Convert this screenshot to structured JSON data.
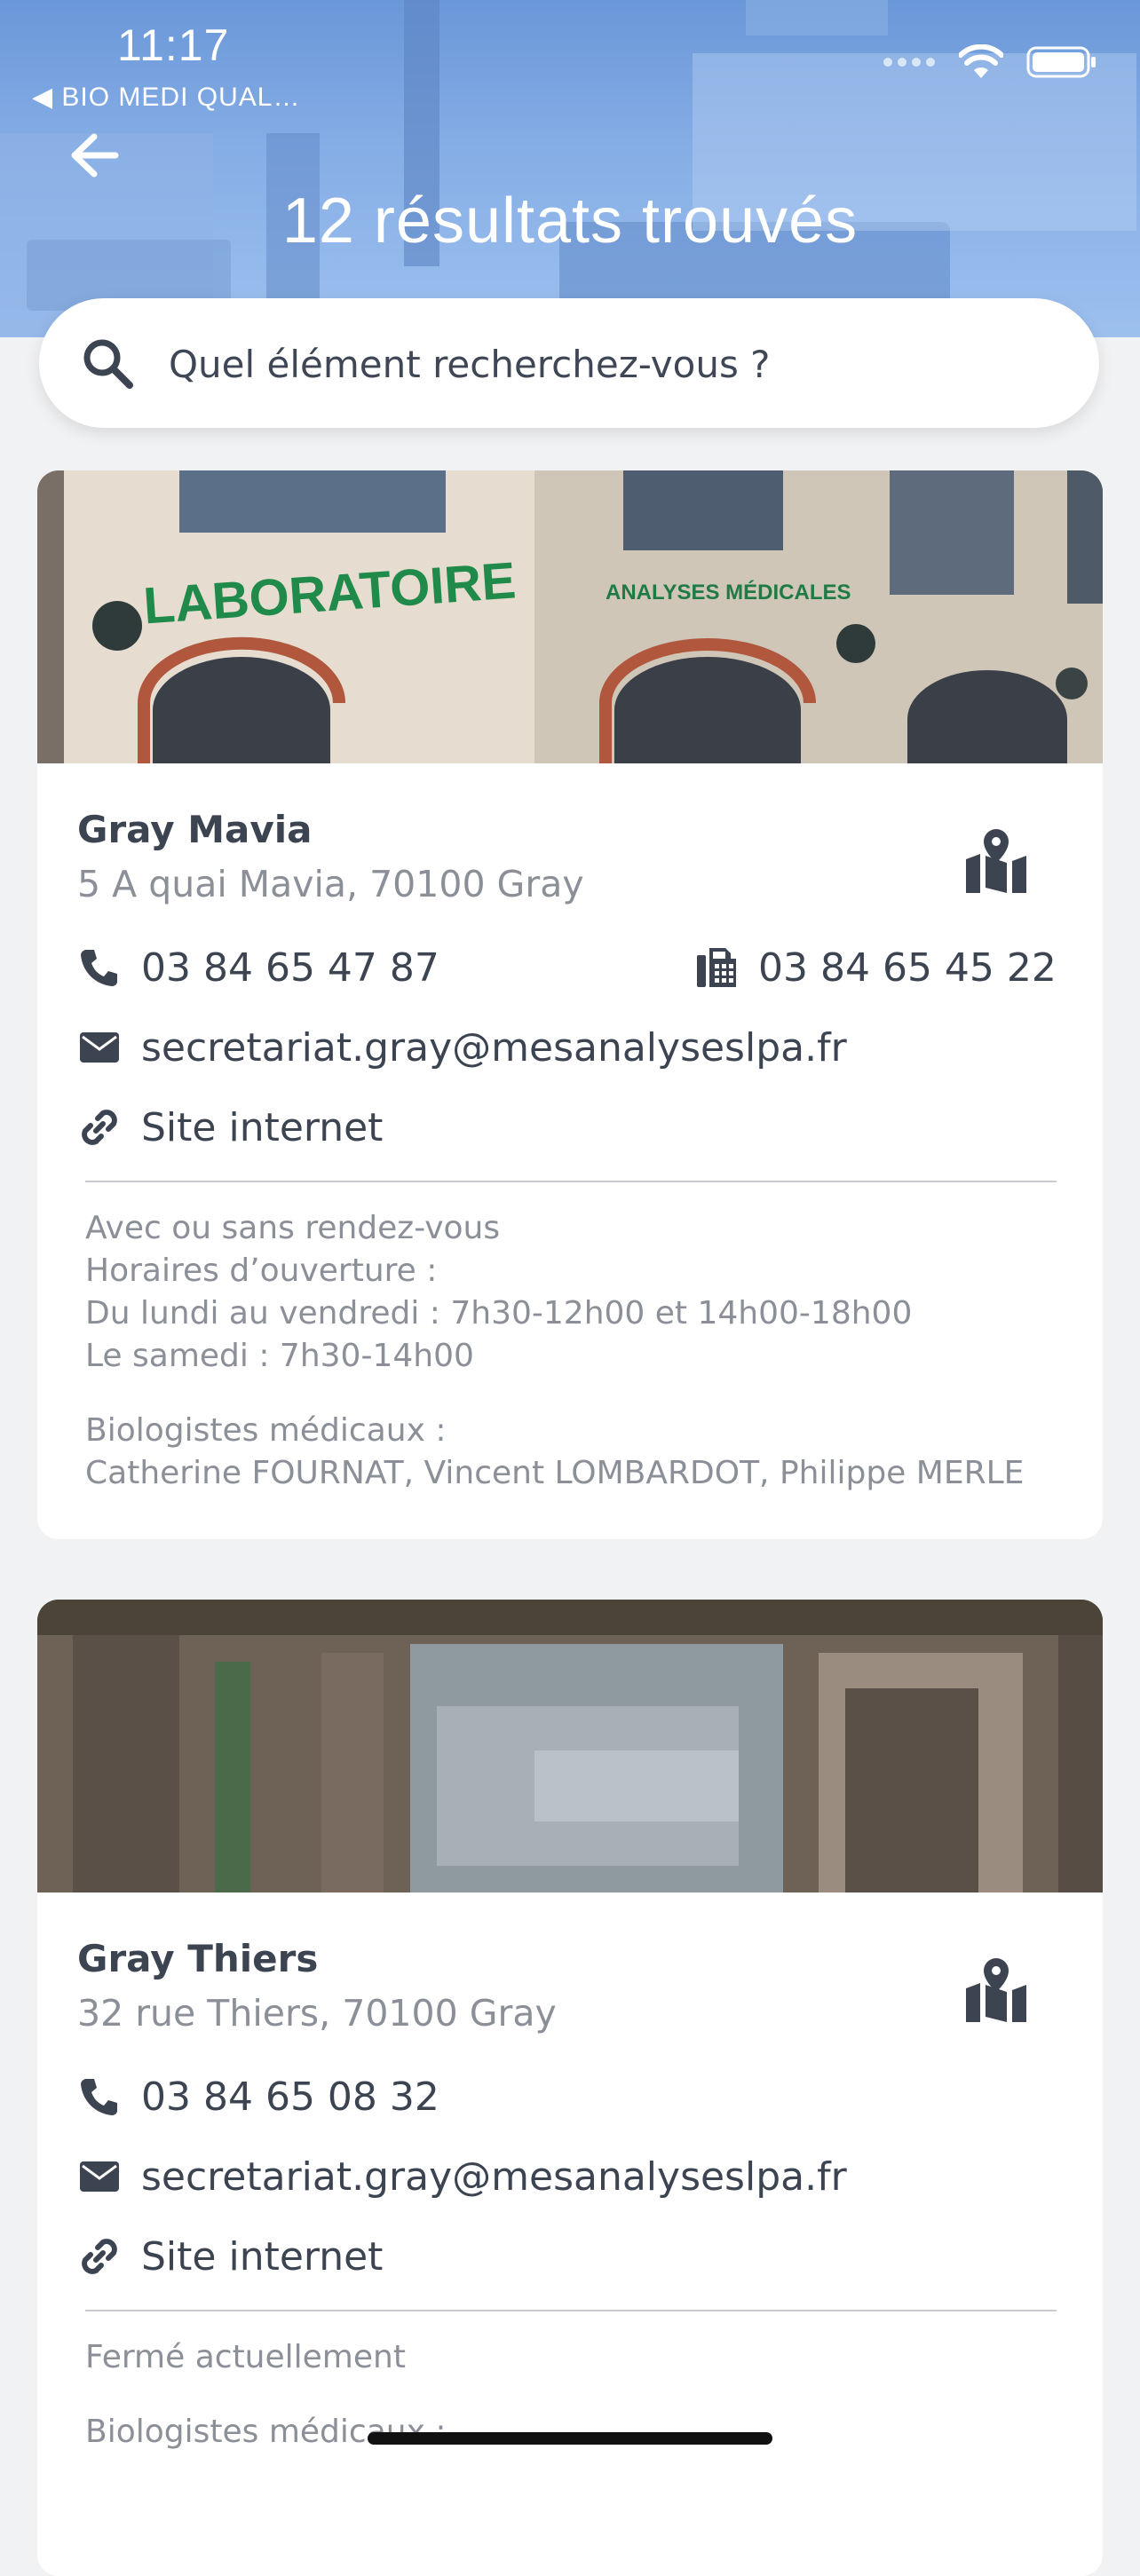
{
  "status_bar": {
    "time": "11:17",
    "back_app": "◀ BIO MEDI QUAL…"
  },
  "header": {
    "title": "12 résultats trouvés"
  },
  "search": {
    "placeholder": "Quel élément recherchez-vous ?"
  },
  "labs": [
    {
      "name": "Gray Mavia",
      "address": "5 A quai Mavia, 70100 Gray",
      "phone": "03 84 65 47 87",
      "fax": "03 84 65 45 22",
      "email": "secretariat.gray@mesanalyseslpa.fr",
      "website": "Site internet",
      "hours": [
        "Avec ou sans rendez-vous",
        "Horaires d’ouverture :",
        "Du lundi au vendredi : 7h30-12h00 et 14h00-18h00",
        "Le samedi : 7h30-14h00"
      ],
      "biologists_label": "Biologistes médicaux :",
      "biologists": "Catherine FOURNAT, Vincent LOMBARDOT, Philippe MERLE"
    },
    {
      "name": "Gray Thiers",
      "address": "32 rue Thiers, 70100 Gray",
      "phone": "03 84 65 08 32",
      "email": "secretariat.gray@mesanalyseslpa.fr",
      "website": "Site internet",
      "status": "Fermé actuellement",
      "biologists_label": "Biologistes médicaux :"
    }
  ],
  "colors": {
    "header_blue": "#7aa3e0",
    "text_dark": "#3c4452",
    "text_muted": "#8b8f97",
    "background": "#f1f2f4"
  },
  "icons": [
    "back-arrow-icon",
    "search-icon",
    "map-icon",
    "phone-icon",
    "fax-icon",
    "envelope-icon",
    "link-icon",
    "wifi-icon",
    "battery-icon"
  ]
}
